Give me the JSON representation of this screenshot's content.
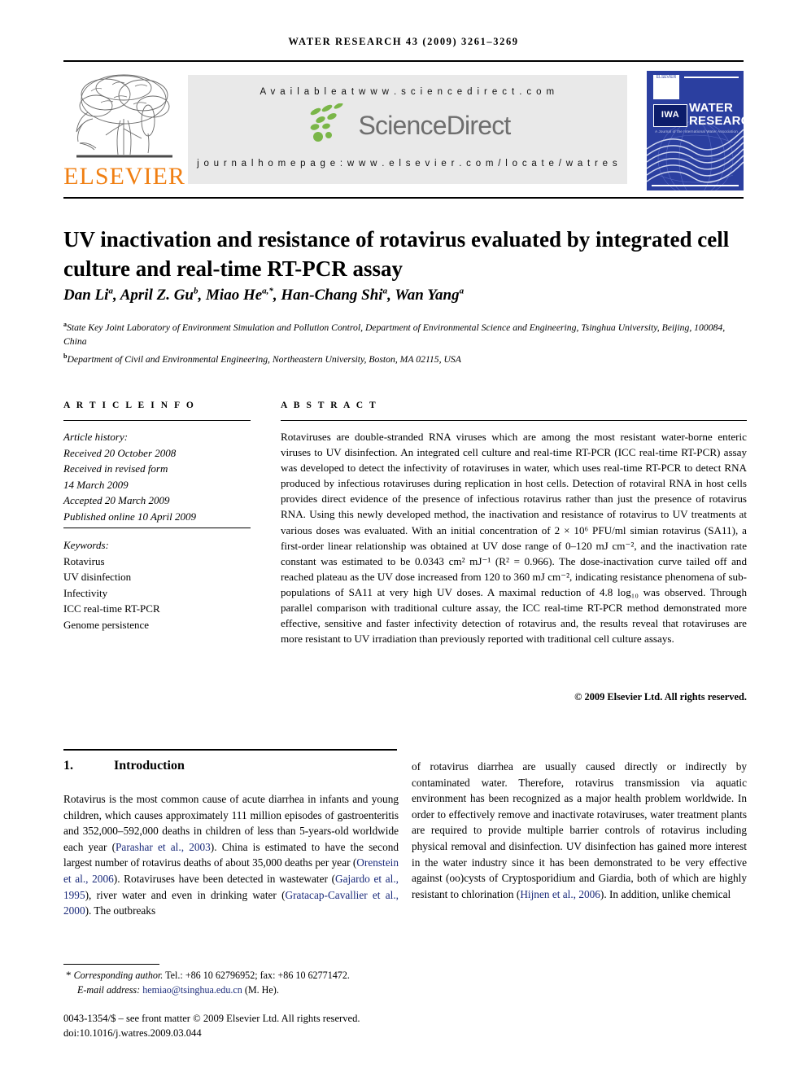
{
  "running_head": "WATER RESEARCH 43 (2009) 3261–3269",
  "masthead": {
    "elsevier_wordmark": "ELSEVIER",
    "available_at": "A v a i l a b l e   a t   w w w . s c i e n c e d i r e c t . c o m",
    "sciencedirect_word": "ScienceDirect",
    "journal_homepage": "j o u r n a l   h o m e p a g e :   w w w . e l s e v i e r . c o m / l o c a t e / w a t r e s",
    "cover": {
      "iwa_label": "IWA",
      "title_line1": "WATER",
      "title_line2": "RESEARCH",
      "subtitle": "A Journal of the International Water Association",
      "elsevier_mark": "ELSEVIER"
    },
    "colors": {
      "elsevier_orange": "#F07F12",
      "cover_blue": "#2b3fa0",
      "sciencedirect_grey": "#6e6e6e",
      "panel_grey": "#e9e9e9"
    }
  },
  "article": {
    "title": "UV inactivation and resistance of rotavirus evaluated by integrated cell culture and real-time RT-PCR assay",
    "authors": [
      {
        "name": "Dan Li",
        "sup": "a"
      },
      {
        "name": "April Z. Gu",
        "sup": "b"
      },
      {
        "name": "Miao He",
        "sup": "a,*"
      },
      {
        "name": "Han-Chang Shi",
        "sup": "a"
      },
      {
        "name": "Wan Yang",
        "sup": "a"
      }
    ],
    "affiliations": [
      {
        "label": "a",
        "text": "State Key Joint Laboratory of Environment Simulation and Pollution Control, Department of Environmental Science and Engineering, Tsinghua University, Beijing, 100084, China"
      },
      {
        "label": "b",
        "text": "Department of Civil and Environmental Engineering, Northeastern University, Boston, MA 02115, USA"
      }
    ]
  },
  "article_info": {
    "heading": "A R T I C L E   I N F O",
    "history_label": "Article history:",
    "history": [
      "Received 20 October 2008",
      "Received in revised form",
      "14 March 2009",
      "Accepted 20 March 2009",
      "Published online 10 April 2009"
    ],
    "keywords_label": "Keywords:",
    "keywords": [
      "Rotavirus",
      "UV disinfection",
      "Infectivity",
      "ICC real-time RT-PCR",
      "Genome persistence"
    ]
  },
  "abstract": {
    "heading": "A B S T R A C T",
    "text": "Rotaviruses are double-stranded RNA viruses which are among the most resistant water-borne enteric viruses to UV disinfection. An integrated cell culture and real-time RT-PCR (ICC real-time RT-PCR) assay was developed to detect the infectivity of rotaviruses in water, which uses real-time RT-PCR to detect RNA produced by infectious rotaviruses during replication in host cells. Detection of rotaviral RNA in host cells provides direct evidence of the presence of infectious rotavirus rather than just the presence of rotavirus RNA. Using this newly developed method, the inactivation and resistance of rotavirus to UV treatments at various doses was evaluated. With an initial concentration of 2 × 10⁶ PFU/ml simian rotavirus (SA11), a first-order linear relationship was obtained at UV dose range of 0–120 mJ cm⁻², and the inactivation rate constant was estimated to be 0.0343 cm² mJ⁻¹ (R² = 0.966). The dose-inactivation curve tailed off and reached plateau as the UV dose increased from 120 to 360 mJ cm⁻², indicating resistance phenomena of sub-populations of SA11 at very high UV doses. A maximal reduction of 4.8 log₁₀ was observed. Through parallel comparison with traditional culture assay, the ICC real-time RT-PCR method demonstrated more effective, sensitive and faster infectivity detection of rotavirus and, the results reveal that rotaviruses are more resistant to UV irradiation than previously reported with traditional cell culture assays.",
    "copyright": "© 2009 Elsevier Ltd. All rights reserved."
  },
  "body": {
    "section_number": "1.",
    "section_title": "Introduction",
    "left_column": "Rotavirus is the most common cause of acute diarrhea in infants and young children, which causes approximately 111 million episodes of gastroenteritis and 352,000–592,000 deaths in children of less than 5-years-old worldwide each year (Parashar et al., 2003). China is estimated to have the second largest number of rotavirus deaths of about 35,000 deaths per year (Orenstein et al., 2006). Rotaviruses have been detected in wastewater (Gajardo et al., 1995), river water and even in drinking water (Gratacap-Cavallier et al., 2000). The outbreaks",
    "right_column": "of rotavirus diarrhea are usually caused directly or indirectly by contaminated water. Therefore, rotavirus transmission via aquatic environment has been recognized as a major health problem worldwide. In order to effectively remove and inactivate rotaviruses, water treatment plants are required to provide multiple barrier controls of rotavirus including physical removal and disinfection. UV disinfection has gained more interest in the water industry since it has been demonstrated to be very effective against (oo)cysts of Cryptosporidium and Giardia, both of which are highly resistant to chlorination (Hijnen et al., 2006). In addition, unlike chemical",
    "citations": [
      "Parashar et al., 2003",
      "Orenstein et al., 2006",
      "Gajardo et al., 1995",
      "Gratacap-Cavallier et al., 2000",
      "Hijnen et al., 2006"
    ],
    "citation_color": "#1a2a7a"
  },
  "footer": {
    "corresponding_label": "Corresponding author.",
    "contact": "Tel.: +86 10 62796952; fax: +86 10 62771472.",
    "email_label": "E-mail address:",
    "email": "hemiao@tsinghua.edu.cn",
    "email_owner": "(M. He).",
    "issn_line": "0043-1354/$ – see front matter © 2009 Elsevier Ltd. All rights reserved.",
    "doi_line": "doi:10.1016/j.watres.2009.03.044"
  }
}
